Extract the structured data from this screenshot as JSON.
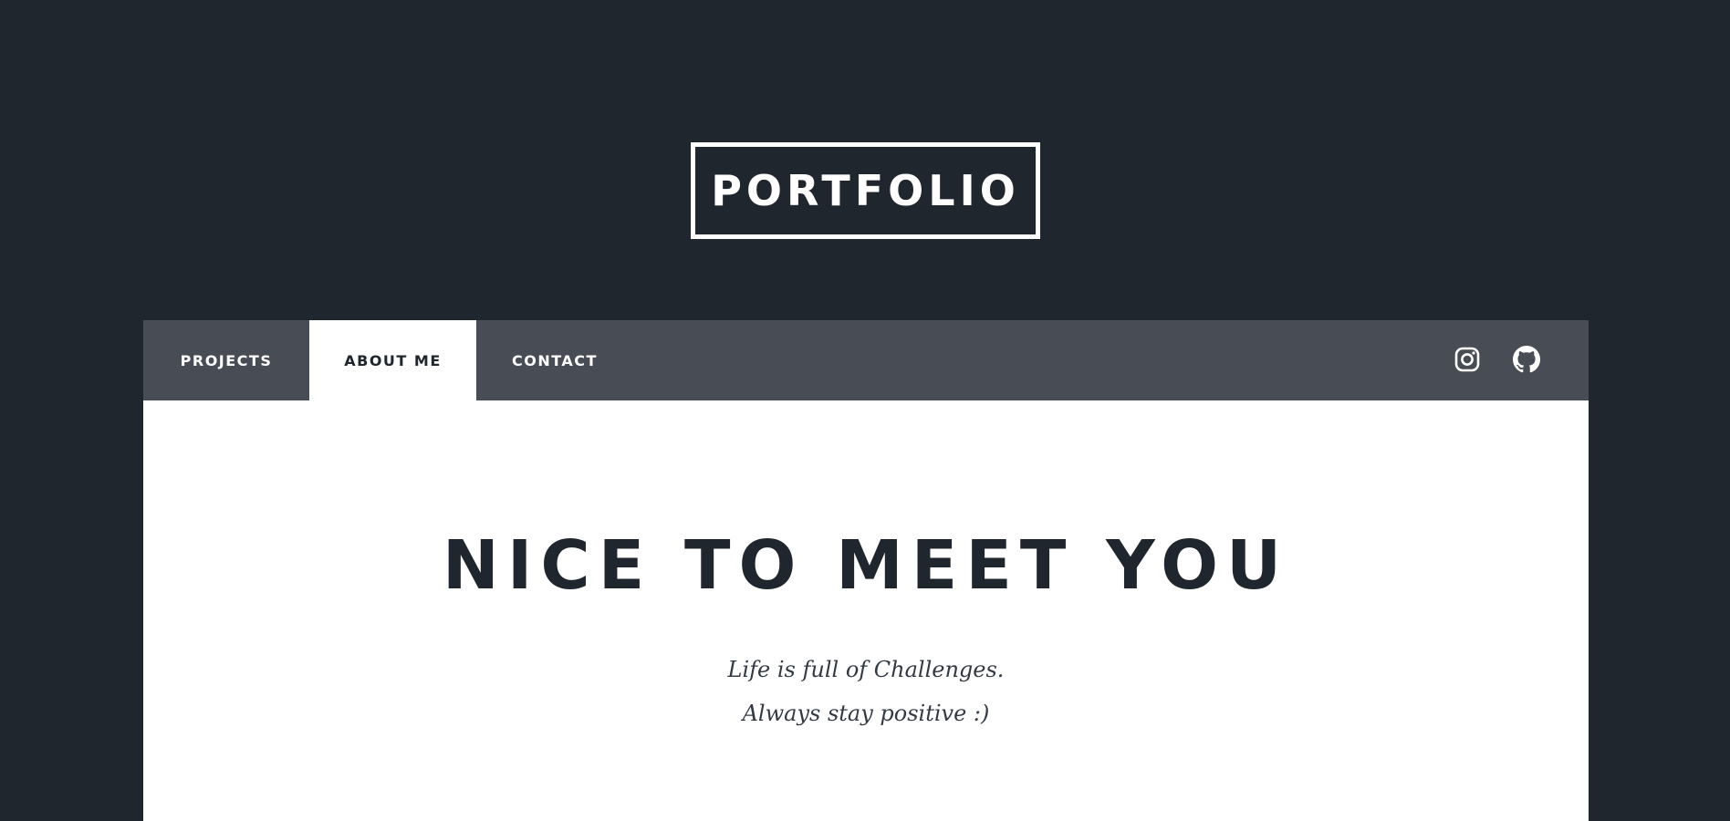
{
  "header": {
    "logo_text": "PORTFOLIO"
  },
  "nav": {
    "items": [
      {
        "label": "PROJECTS",
        "active": false
      },
      {
        "label": "ABOUT ME",
        "active": true
      },
      {
        "label": "CONTACT",
        "active": false
      }
    ],
    "social": [
      "instagram-icon",
      "github-icon"
    ]
  },
  "main": {
    "headline": "NICE TO MEET YOU",
    "tagline_lines": [
      "Life is full of Challenges.",
      "Always stay positive :)"
    ]
  },
  "colors": {
    "background": "#20262e",
    "navbar": "#484d55",
    "content": "#ffffff",
    "text_dark": "#20262e"
  }
}
